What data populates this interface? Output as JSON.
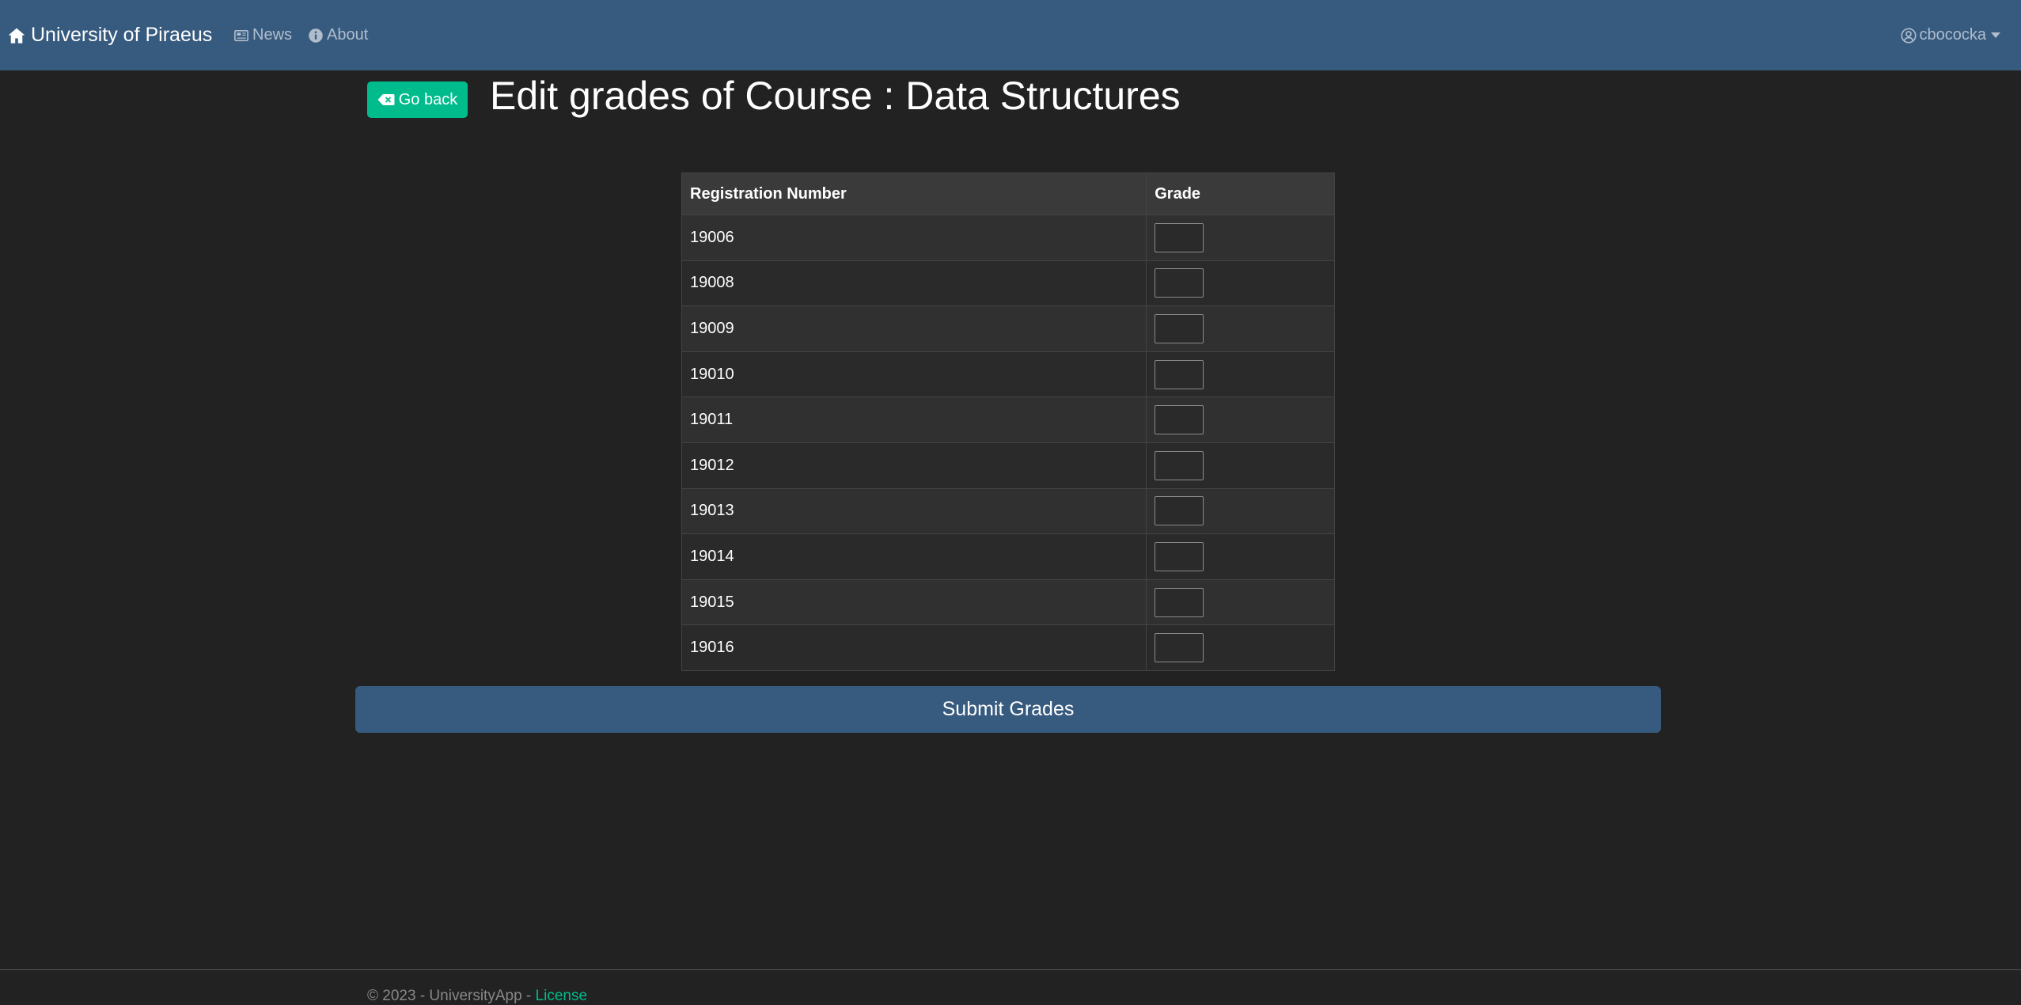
{
  "navbar": {
    "brand": "University of Piraeus",
    "brand_icon": "home-icon",
    "links": [
      {
        "label": "News",
        "icon": "newspaper-icon"
      },
      {
        "label": "About",
        "icon": "info-circle-icon"
      }
    ],
    "user": {
      "name": "cbococka",
      "icon": "user-circle-icon"
    }
  },
  "header": {
    "back_label": "Go back",
    "back_icon": "backspace-icon",
    "title": "Edit grades of Course : Data Structures"
  },
  "table": {
    "columns": [
      "Registration Number",
      "Grade"
    ],
    "rows": [
      {
        "reg": "19006",
        "grade": ""
      },
      {
        "reg": "19008",
        "grade": ""
      },
      {
        "reg": "19009",
        "grade": ""
      },
      {
        "reg": "19010",
        "grade": ""
      },
      {
        "reg": "19011",
        "grade": ""
      },
      {
        "reg": "19012",
        "grade": ""
      },
      {
        "reg": "19013",
        "grade": ""
      },
      {
        "reg": "19014",
        "grade": ""
      },
      {
        "reg": "19015",
        "grade": ""
      },
      {
        "reg": "19016",
        "grade": ""
      }
    ]
  },
  "submit_label": "Submit Grades",
  "footer": {
    "text": "© 2023 - UniversityApp - ",
    "link": "License"
  },
  "colors": {
    "navbar": "#375a7f",
    "background": "#222222",
    "accent": "#00bc8c"
  }
}
